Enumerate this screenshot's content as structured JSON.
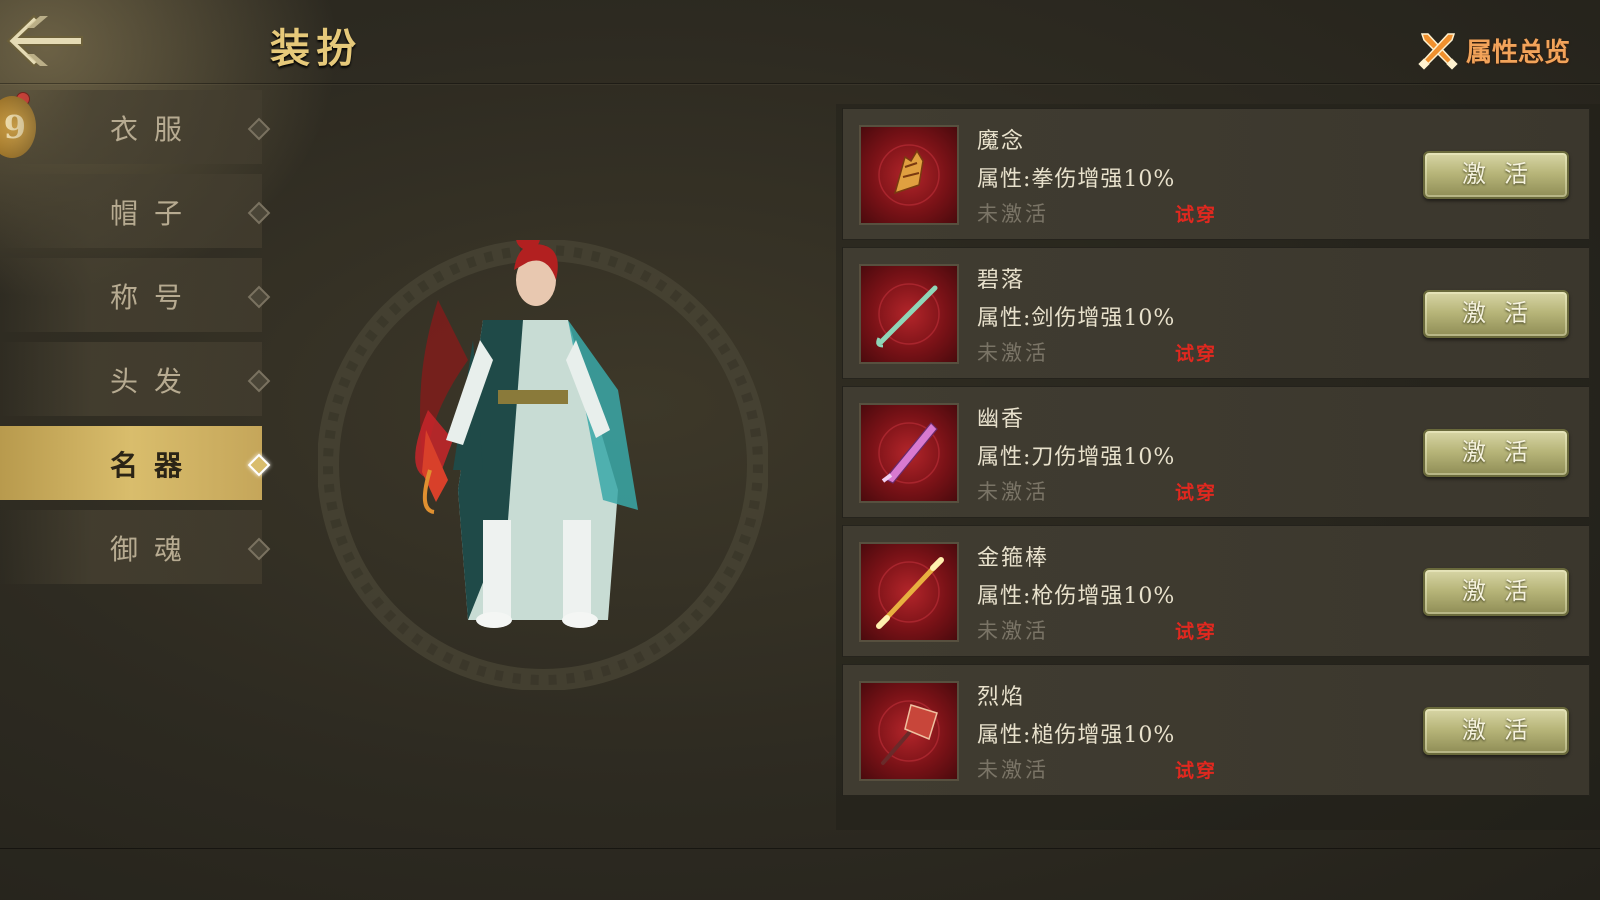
{
  "header": {
    "title": "装扮",
    "attr_overview_label": "属性总览"
  },
  "level_badge": "9",
  "sidebar": {
    "items": [
      {
        "label": "衣服",
        "active": false
      },
      {
        "label": "帽子",
        "active": false
      },
      {
        "label": "称号",
        "active": false
      },
      {
        "label": "头发",
        "active": false
      },
      {
        "label": "名器",
        "active": true
      },
      {
        "label": "御魂",
        "active": false
      }
    ]
  },
  "items": [
    {
      "name": "魔念",
      "attr": "属性:拳伤增强10%",
      "status": "未激活",
      "try_on": "试穿",
      "button": "激活",
      "icon": "claw-weapon-icon",
      "weapon_color": "#e0a040"
    },
    {
      "name": "碧落",
      "attr": "属性:剑伤增强10%",
      "status": "未激活",
      "try_on": "试穿",
      "button": "激活",
      "icon": "sword-icon",
      "weapon_color": "#8fd6b8"
    },
    {
      "name": "幽香",
      "attr": "属性:刀伤增强10%",
      "status": "未激活",
      "try_on": "试穿",
      "button": "激活",
      "icon": "blade-icon",
      "weapon_color": "#d87ad0"
    },
    {
      "name": "金箍棒",
      "attr": "属性:枪伤增强10%",
      "status": "未激活",
      "try_on": "试穿",
      "button": "激活",
      "icon": "staff-icon",
      "weapon_color": "#e8b040"
    },
    {
      "name": "烈焰",
      "attr": "属性:槌伤增强10%",
      "status": "未激活",
      "try_on": "试穿",
      "button": "激活",
      "icon": "hammer-icon",
      "weapon_color": "#c8463a"
    }
  ]
}
